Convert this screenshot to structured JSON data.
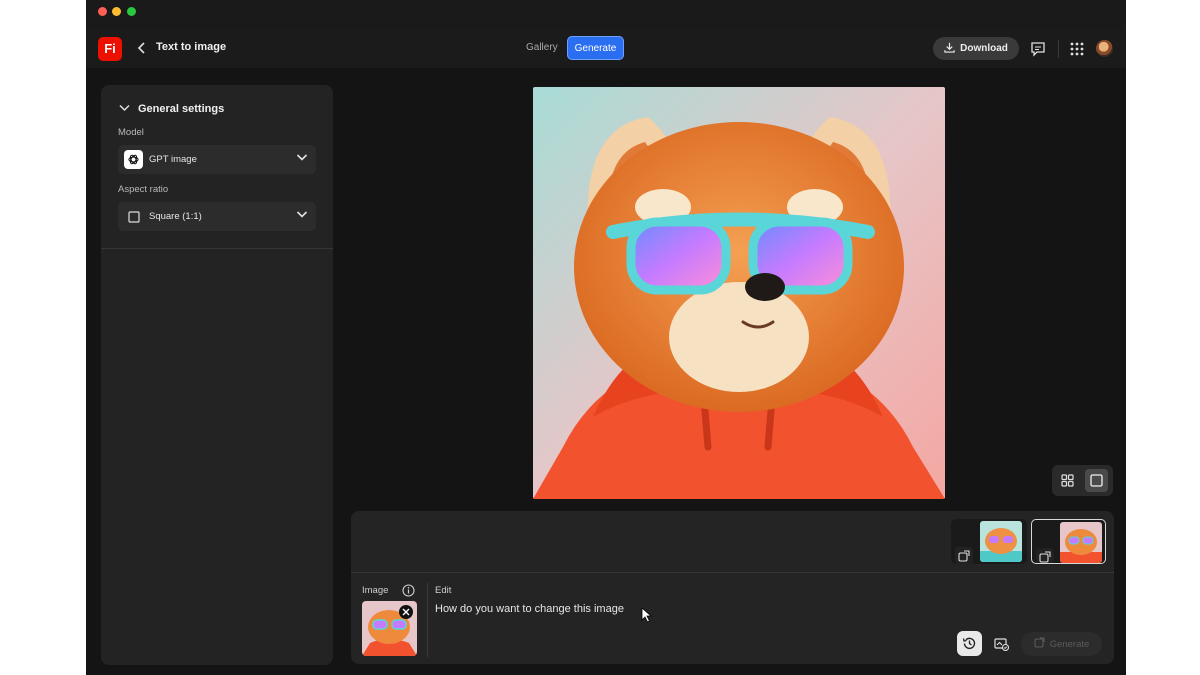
{
  "header": {
    "logo_text": "Fi",
    "title": "Text to image",
    "gallery_label": "Gallery",
    "generate_label": "Generate",
    "download_label": "Download"
  },
  "settings": {
    "section_title": "General settings",
    "model_label": "Model",
    "model_value": "GPT image",
    "aspect_label": "Aspect ratio",
    "aspect_value": "Square (1:1)"
  },
  "prompt_area": {
    "image_label": "Image",
    "edit_label": "Edit",
    "prompt_text": "How do you want to change this image",
    "generate_label": "Generate"
  },
  "colors": {
    "accent": "#2a6ef1",
    "brand": "#eb1000",
    "background": "#141414",
    "panel": "#232323"
  },
  "icons": [
    "back-icon",
    "download-icon",
    "comment-icon",
    "apps-grid-icon",
    "chevron-down-icon",
    "openai-icon",
    "square-icon",
    "grid-view-icon",
    "single-view-icon",
    "remix-icon",
    "info-icon",
    "close-icon",
    "history-icon",
    "style-reference-icon",
    "generate-icon"
  ]
}
